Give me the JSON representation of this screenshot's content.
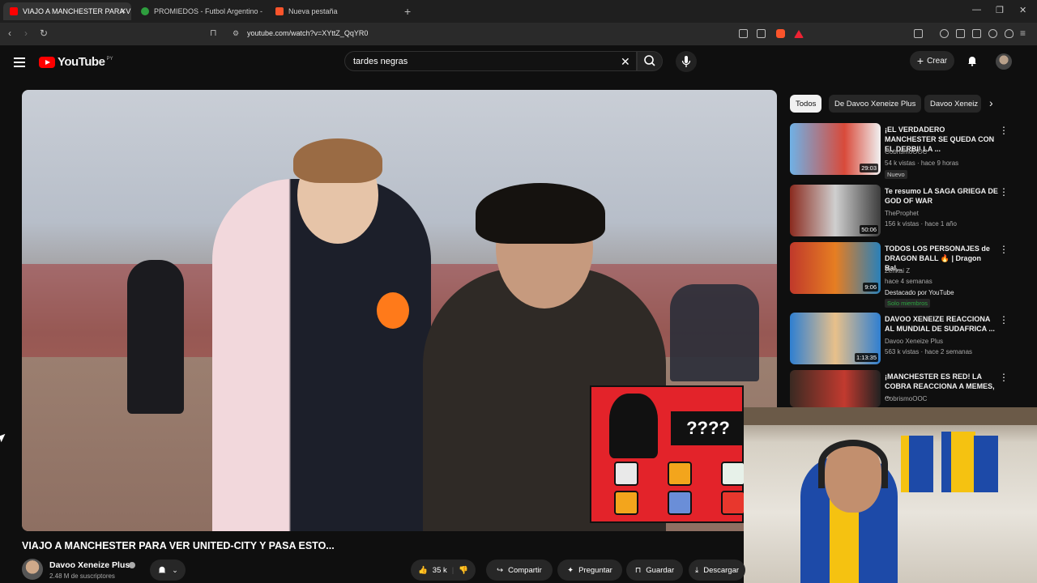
{
  "browser": {
    "tabs": [
      {
        "label": "VIAJO A MANCHESTER PARA VER",
        "active": true,
        "favicon_color": "#ff0000"
      },
      {
        "label": "PROMIEDOS - Futbol Argentino - Fix",
        "active": false,
        "favicon_color": "#2e9e3e"
      },
      {
        "label": "Nueva pestaña",
        "active": false,
        "favicon_color": "#fb542b"
      }
    ],
    "url": "youtube.com/watch?v=XYttZ_QqYR0"
  },
  "header": {
    "logo_text": "YouTube",
    "logo_country": "PY",
    "search_value": "tardes negras",
    "create_label": "Crear"
  },
  "video": {
    "overlay_question": "????",
    "title": "VIAJO A MANCHESTER PARA VER UNITED-CITY Y PASA ESTO...",
    "channel_name": "Davoo Xeneize Plus",
    "subscribers": "2.48 M de suscriptores",
    "likes": "35 k",
    "actions": {
      "share": "Compartir",
      "ask": "Preguntar",
      "save": "Guardar",
      "download": "Descargar"
    }
  },
  "sidebar": {
    "chips": [
      "Todos",
      "De Davoo Xeneize Plus",
      "Davoo Xeneiz"
    ],
    "recommendations": [
      {
        "title": "¡EL VERDADERO MANCHESTER SE QUEDA CON EL DERBI! LA ...",
        "channel": "CobrismoOOC",
        "meta": "54 k vistas · hace 9 horas",
        "badge": "Nuevo",
        "duration": "29:03"
      },
      {
        "title": "Te resumo LA SAGA GRIEGA DE GOD OF WAR",
        "channel": "TheProphet",
        "meta": "156 k vistas · hace 1 año",
        "badge": "",
        "duration": "50:06"
      },
      {
        "title": "TODOS LOS PERSONAJES de DRAGON BALL 🔥 | Dragon Bal...",
        "channel": "Zenkai Z",
        "meta": "hace 4 semanas",
        "badge": "Destacado por YouTube",
        "badge2": "Solo miembros",
        "duration": "9:06"
      },
      {
        "title": "DAVOO XENEIZE REACCIONA AL MUNDIAL DE SUDAFRICA ...",
        "channel": "Davoo Xeneize Plus",
        "meta": "563 k vistas · hace 2 semanas",
        "badge": "",
        "duration": "1:13:35"
      },
      {
        "title": "¡MANCHESTER ES RED! LA COBRA REACCIONA A MEMES, ...",
        "channel": "CobrismoOOC",
        "meta": "",
        "badge": "",
        "duration": ""
      }
    ]
  },
  "colors": {
    "brand": "#ff0000",
    "bg": "#0f0f0f",
    "pill": "#272727"
  }
}
